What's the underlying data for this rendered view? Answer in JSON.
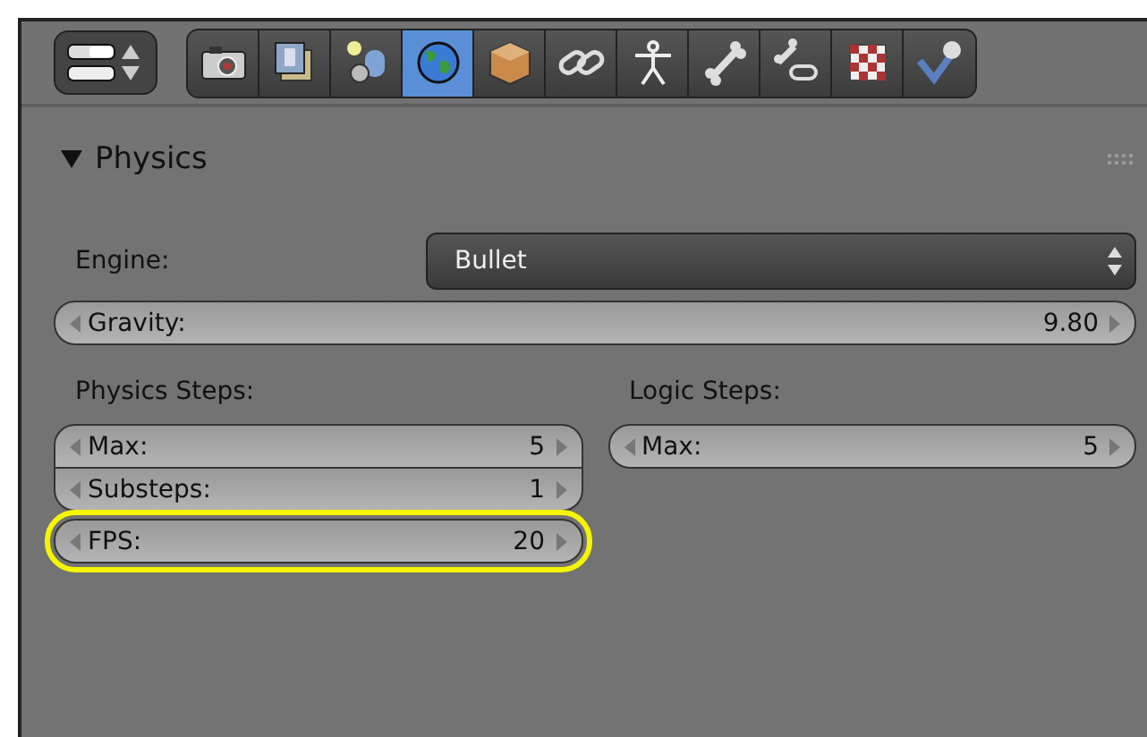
{
  "toolbar": {
    "tabs": [
      {
        "selected": false
      },
      {
        "selected": false
      },
      {
        "selected": false
      },
      {
        "selected": true
      },
      {
        "selected": false
      },
      {
        "selected": false
      },
      {
        "selected": false
      },
      {
        "selected": false
      },
      {
        "selected": false
      },
      {
        "selected": false
      },
      {
        "selected": false
      }
    ]
  },
  "panel": {
    "title": "Physics",
    "expanded": true,
    "engine": {
      "label": "Engine:",
      "value": "Bullet"
    },
    "gravity": {
      "label": "Gravity:",
      "value": "9.80",
      "highlighted": false
    },
    "columns": [
      {
        "heading": "Physics Steps:",
        "fields": [
          {
            "label": "Max:",
            "value": "5",
            "highlighted": false
          },
          {
            "label": "Substeps:",
            "value": "1",
            "highlighted": false
          }
        ],
        "extra": [
          {
            "label": "FPS:",
            "value": "20",
            "highlighted": true
          }
        ]
      },
      {
        "heading": "Logic Steps:",
        "fields": [
          {
            "label": "Max:",
            "value": "5",
            "highlighted": false
          }
        ]
      }
    ]
  }
}
